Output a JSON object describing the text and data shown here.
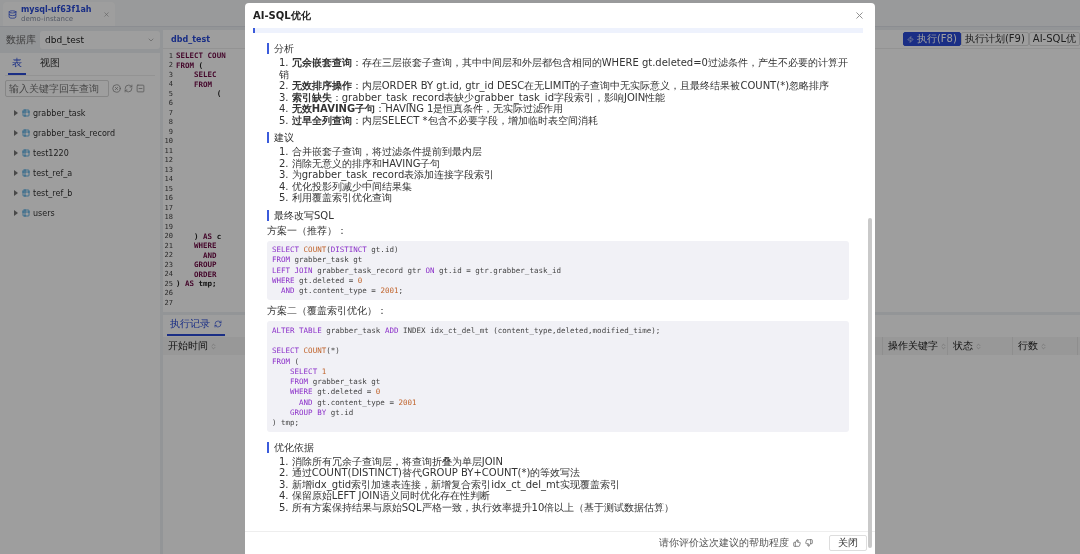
{
  "tab": {
    "title": "mysql-uf63f1ah",
    "subtitle": "demo-instance"
  },
  "database": {
    "label": "数据库",
    "value": "dbd_test"
  },
  "object_tabs": [
    {
      "label": "表",
      "selected": true
    },
    {
      "label": "视图",
      "selected": false
    }
  ],
  "search": {
    "placeholder": "输入关键字回车查询"
  },
  "tables": [
    {
      "name": "grabber_task",
      "expanded": false
    },
    {
      "name": "grabber_task_record",
      "expanded": false
    },
    {
      "name": "test1220",
      "expanded": false
    },
    {
      "name": "test_ref_a",
      "expanded": false
    },
    {
      "name": "test_ref_b",
      "expanded": false
    },
    {
      "name": "users",
      "expanded": false
    }
  ],
  "editor": {
    "tab": "dbd_test",
    "buttons": [
      {
        "label": "执行(F8)",
        "primary": true
      },
      {
        "label": "执行计划(F9)",
        "primary": false
      },
      {
        "label": "AI-SQL优",
        "primary": false
      }
    ],
    "lines": [
      {
        "number": "1",
        "tokens": [
          {
            "text": "SELECT COUN",
            "kind": "kw"
          }
        ]
      },
      {
        "number": "2",
        "tokens": [
          {
            "text": "FROM",
            "kind": "kw"
          },
          {
            "text": " (",
            "kind": "plain"
          }
        ]
      },
      {
        "number": "3",
        "tokens": [
          {
            "text": "    SELEC",
            "kind": "kw"
          }
        ]
      },
      {
        "number": "4",
        "tokens": [
          {
            "text": "    FROM",
            "kind": "kw"
          }
        ]
      },
      {
        "number": "5",
        "tokens": [
          {
            "text": "         (",
            "kind": "plain"
          }
        ]
      },
      {
        "number": "6"
      },
      {
        "number": "7"
      },
      {
        "number": "8"
      },
      {
        "number": "9"
      },
      {
        "number": "10"
      },
      {
        "number": "11"
      },
      {
        "number": "12"
      },
      {
        "number": "13"
      },
      {
        "number": "14"
      },
      {
        "number": "15"
      },
      {
        "number": "16"
      },
      {
        "number": "17"
      },
      {
        "number": "18"
      },
      {
        "number": "19"
      },
      {
        "number": "20",
        "tokens": [
          {
            "text": "    ) ",
            "kind": "plain"
          },
          {
            "text": "AS",
            "kind": "kw"
          },
          {
            "text": " c",
            "kind": "plain"
          }
        ]
      },
      {
        "number": "21",
        "tokens": [
          {
            "text": "    WHERE",
            "kind": "kw"
          }
        ]
      },
      {
        "number": "22",
        "tokens": [
          {
            "text": "      AND",
            "kind": "kw"
          }
        ]
      },
      {
        "number": "23",
        "tokens": [
          {
            "text": "    GROUP",
            "kind": "kw"
          }
        ]
      },
      {
        "number": "24",
        "tokens": [
          {
            "text": "    ORDER",
            "kind": "kw"
          }
        ]
      },
      {
        "number": "25",
        "tokens": [
          {
            "text": ") ",
            "kind": "plain"
          },
          {
            "text": "AS",
            "kind": "kw"
          },
          {
            "text": " tmp;",
            "kind": "plain"
          }
        ]
      },
      {
        "number": "26"
      },
      {
        "number": "27"
      }
    ]
  },
  "history": {
    "tab": "执行记录",
    "columns": [
      {
        "label": "开始时间"
      },
      {
        "label": "操作关键字"
      },
      {
        "label": "状态"
      },
      {
        "label": "行数"
      }
    ]
  },
  "dialog": {
    "title": "AI-SQL优化",
    "sections": [
      {
        "heading": "分析",
        "kind": "list",
        "items": [
          {
            "number": "1.",
            "text": "**冗余嵌套查询**：存在三层嵌套子查询，其中中间层和外层都包含相同的WHERE gt.deleted=0过滤条件，产生不必要的计算开销"
          },
          {
            "number": "2.",
            "text": "**无效排序操作**：内层ORDER BY gt.id, gtr_id DESC在无LIMIT的子查询中无实际意义，且最终结果被COUNT(*)忽略排序"
          },
          {
            "number": "3.",
            "text": "**索引缺失**：grabber_task_record表缺少grabber_task_id字段索引，影响JOIN性能"
          },
          {
            "number": "4.",
            "text": "**无效HAVING子句**：HAVING 1是恒真条件，无实际过滤作用"
          },
          {
            "number": "5.",
            "text": "**过早全列查询**：内层SELECT *包含不必要字段，增加临时表空间消耗"
          }
        ]
      },
      {
        "heading": "建议",
        "kind": "list",
        "items": [
          {
            "number": "1.",
            "text": "合并嵌套子查询，将过滤条件提前到最内层"
          },
          {
            "number": "2.",
            "text": "消除无意义的排序和HAVING子句"
          },
          {
            "number": "3.",
            "text": "为grabber_task_record表添加连接字段索引"
          },
          {
            "number": "4.",
            "text": "优化投影列减少中间结果集"
          },
          {
            "number": "5.",
            "text": "利用覆盖索引优化查询"
          }
        ]
      },
      {
        "heading": "最终改写SQL",
        "kind": "sql",
        "plans": [
          {
            "label": "方案一（推荐）：",
            "lines": [
              {
                "kind": "code",
                "tokens": [
                  {
                    "text": "SELECT ",
                    "kind": "kw"
                  },
                  {
                    "text": "COUNT",
                    "kind": "fn"
                  },
                  {
                    "text": "(",
                    "kind": "plain"
                  },
                  {
                    "text": "DISTINCT",
                    "kind": "kw"
                  },
                  {
                    "text": " gt.id)",
                    "kind": "plain"
                  }
                ]
              },
              {
                "kind": "code",
                "tokens": [
                  {
                    "text": "FROM",
                    "kind": "kw"
                  },
                  {
                    "text": " grabber_task gt",
                    "kind": "plain"
                  }
                ]
              },
              {
                "kind": "code",
                "tokens": [
                  {
                    "text": "LEFT JOIN",
                    "kind": "kw"
                  },
                  {
                    "text": " grabber_task_record gtr ",
                    "kind": "plain"
                  },
                  {
                    "text": "ON",
                    "kind": "kw"
                  },
                  {
                    "text": " gt.id = gtr.grabber_task_id",
                    "kind": "plain"
                  }
                ]
              },
              {
                "kind": "code",
                "tokens": [
                  {
                    "text": "WHERE",
                    "kind": "kw"
                  },
                  {
                    "text": " gt.deleted = ",
                    "kind": "plain"
                  },
                  {
                    "text": "0",
                    "kind": "num"
                  }
                ]
              },
              {
                "kind": "code",
                "tokens": [
                  {
                    "text": "  AND",
                    "kind": "kw"
                  },
                  {
                    "text": " gt.content_type = ",
                    "kind": "plain"
                  },
                  {
                    "text": "2001",
                    "kind": "num"
                  },
                  {
                    "text": ";",
                    "kind": "plain"
                  }
                ]
              }
            ]
          },
          {
            "label": "方案二（覆盖索引优化）：",
            "lines": [
              {
                "kind": "code",
                "tokens": [
                  {
                    "text": "ALTER TABLE",
                    "kind": "kw"
                  },
                  {
                    "text": " grabber_task ",
                    "kind": "plain"
                  },
                  {
                    "text": "ADD",
                    "kind": "kw"
                  },
                  {
                    "text": " INDEX idx_ct_del_mt (content_type,deleted,modified_time);",
                    "kind": "plain"
                  }
                ]
              },
              {
                "kind": "blank"
              },
              {
                "kind": "code",
                "tokens": [
                  {
                    "text": "SELECT ",
                    "kind": "kw"
                  },
                  {
                    "text": "COUNT",
                    "kind": "fn"
                  },
                  {
                    "text": "(*)",
                    "kind": "plain"
                  }
                ]
              },
              {
                "kind": "code",
                "tokens": [
                  {
                    "text": "FROM",
                    "kind": "kw"
                  },
                  {
                    "text": " (",
                    "kind": "plain"
                  }
                ]
              },
              {
                "kind": "code",
                "tokens": [
                  {
                    "text": "    SELECT ",
                    "kind": "kw"
                  },
                  {
                    "text": "1",
                    "kind": "num"
                  }
                ]
              },
              {
                "kind": "code",
                "tokens": [
                  {
                    "text": "    FROM",
                    "kind": "kw"
                  },
                  {
                    "text": " grabber_task gt",
                    "kind": "plain"
                  }
                ]
              },
              {
                "kind": "code",
                "tokens": [
                  {
                    "text": "    WHERE",
                    "kind": "kw"
                  },
                  {
                    "text": " gt.deleted = ",
                    "kind": "plain"
                  },
                  {
                    "text": "0",
                    "kind": "num"
                  }
                ]
              },
              {
                "kind": "code",
                "tokens": [
                  {
                    "text": "      AND",
                    "kind": "kw"
                  },
                  {
                    "text": " gt.content_type = ",
                    "kind": "plain"
                  },
                  {
                    "text": "2001",
                    "kind": "num"
                  }
                ]
              },
              {
                "kind": "code",
                "tokens": [
                  {
                    "text": "    GROUP BY",
                    "kind": "kw"
                  },
                  {
                    "text": " gt.id",
                    "kind": "plain"
                  }
                ]
              },
              {
                "kind": "code",
                "tokens": [
                  {
                    "text": ") tmp;",
                    "kind": "plain"
                  }
                ]
              }
            ]
          }
        ]
      },
      {
        "heading": "优化依据",
        "kind": "list",
        "items": [
          {
            "number": "1.",
            "text": "消除所有冗余子查询层，将查询折叠为单层JOIN"
          },
          {
            "number": "2.",
            "text": "通过COUNT(DISTINCT)替代GROUP BY+COUNT(*)的等效写法"
          },
          {
            "number": "3.",
            "text": "新增idx_gtid索引加速表连接，新增复合索引idx_ct_del_mt实现覆盖索引"
          },
          {
            "number": "4.",
            "text": "保留原始LEFT JOIN语义同时优化存在性判断"
          },
          {
            "number": "5.",
            "text": "所有方案保持结果与原始SQL严格一致，执行效率提升10倍以上（基于测试数据估算）"
          }
        ]
      }
    ],
    "feedback": "请你评价这次建议的帮助程度",
    "close_button": "关闭"
  }
}
